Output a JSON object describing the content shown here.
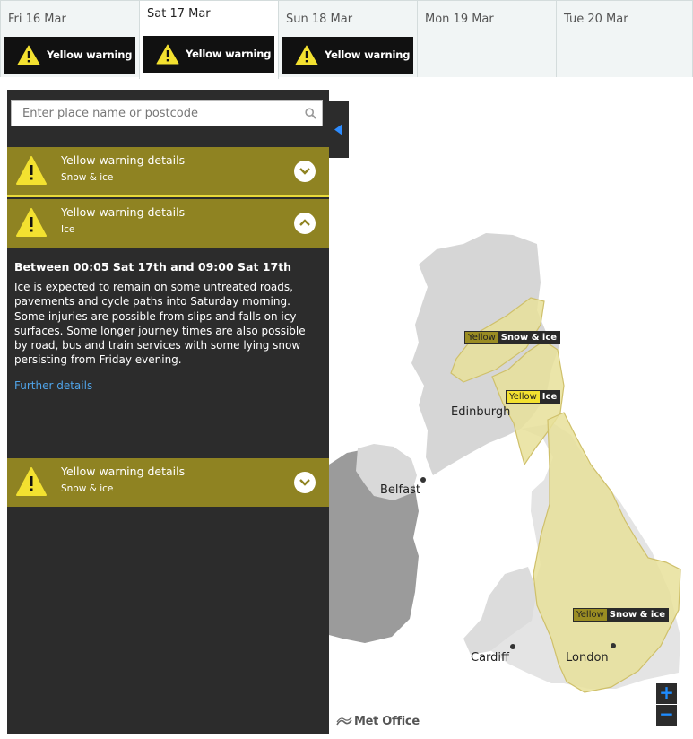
{
  "tabs": [
    {
      "date": "Fri 16 Mar",
      "warning": "Yellow warning"
    },
    {
      "date": "Sat 17 Mar",
      "warning": "Yellow warning"
    },
    {
      "date": "Sun 18 Mar",
      "warning": "Yellow warning"
    },
    {
      "date": "Mon 19 Mar",
      "warning": ""
    },
    {
      "date": "Tue 20 Mar",
      "warning": ""
    }
  ],
  "active_tab": "Sat 17 Mar",
  "search": {
    "placeholder": "Enter place name or postcode",
    "value": ""
  },
  "warnings": [
    {
      "title": "Yellow warning details",
      "type": "Snow & ice",
      "expanded": false
    },
    {
      "title": "Yellow warning details",
      "type": "Ice",
      "expanded": true
    },
    {
      "title": "Yellow warning details",
      "type": "Snow & ice",
      "expanded": false
    }
  ],
  "detail": {
    "heading": "Between 00:05 Sat 17th and 09:00 Sat 17th",
    "body": "Ice is expected to remain on some untreated roads, pavements and cycle paths into Saturday morning. Some injuries are possible from slips and falls on icy surfaces. Some longer journey times are also possible by road, bus and train services with some lying snow persisting from Friday evening.",
    "link": "Further details"
  },
  "map": {
    "cities": {
      "edinburgh": "Edinburgh",
      "belfast": "Belfast",
      "cardiff": "Cardiff",
      "london": "London"
    },
    "labels": [
      {
        "level": "Yellow",
        "type": "Snow & ice"
      },
      {
        "level": "Yellow",
        "type": "Ice"
      },
      {
        "level": "Yellow",
        "type": "Snow & ice"
      }
    ],
    "zoom_in": "+",
    "zoom_out": "−",
    "logo": "Met Office"
  },
  "colors": {
    "warning_yellow": "#8f8322",
    "warning_bright": "#f3e130",
    "panel": "#2c2c2c",
    "link": "#4fa3e8"
  },
  "icons": [
    "warning-triangle-icon",
    "chevron-down-icon",
    "chevron-up-icon",
    "search-icon",
    "collapse-arrow-icon"
  ]
}
